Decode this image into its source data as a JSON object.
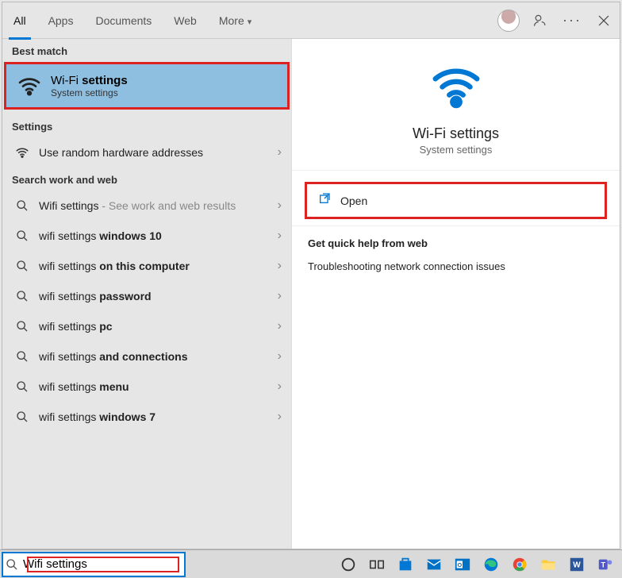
{
  "tabs": {
    "all": "All",
    "apps": "Apps",
    "documents": "Documents",
    "web": "Web",
    "more": "More"
  },
  "sections": {
    "best_match": "Best match",
    "settings": "Settings",
    "search_web": "Search work and web"
  },
  "best_match": {
    "title_prefix": "Wi-Fi ",
    "title_bold": "settings",
    "subtitle": "System settings"
  },
  "settings_rows": [
    {
      "text": "Use random hardware addresses"
    }
  ],
  "web_rows": [
    {
      "pre": "Wifi settings",
      "muted": " - See work and web results",
      "bold": ""
    },
    {
      "pre": "wifi settings ",
      "muted": "",
      "bold": "windows 10"
    },
    {
      "pre": "wifi settings ",
      "muted": "",
      "bold": "on this computer"
    },
    {
      "pre": "wifi settings ",
      "muted": "",
      "bold": "password"
    },
    {
      "pre": "wifi settings ",
      "muted": "",
      "bold": "pc"
    },
    {
      "pre": "wifi settings ",
      "muted": "",
      "bold": "and connections"
    },
    {
      "pre": "wifi settings ",
      "muted": "",
      "bold": "menu"
    },
    {
      "pre": "wifi settings ",
      "muted": "",
      "bold": "windows 7"
    }
  ],
  "detail": {
    "title": "Wi-Fi settings",
    "subtitle": "System settings",
    "open": "Open",
    "help_title": "Get quick help from web",
    "help_link": "Troubleshooting network connection issues"
  },
  "search": {
    "value": "Wifi settings"
  }
}
